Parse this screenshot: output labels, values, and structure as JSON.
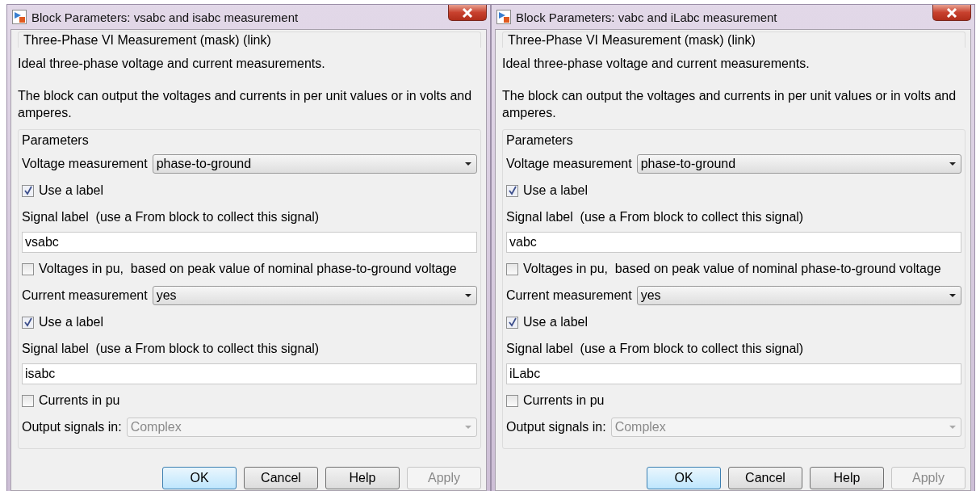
{
  "dialogs": [
    {
      "title": "Block Parameters: vsabc and isabc measurement",
      "header": "Three-Phase VI Measurement (mask) (link)",
      "description": [
        "Ideal three-phase voltage and current measurements.",
        "The block can output the voltages and currents in per unit values or in volts and amperes."
      ],
      "group": "Parameters",
      "rows": [
        {
          "kind": "select",
          "label": "Voltage measurement",
          "value": "phase-to-ground",
          "disabled": false
        },
        {
          "kind": "checkbox",
          "label": "Use a label",
          "checked": true
        },
        {
          "kind": "text",
          "label": "Signal label  (use a From block to collect this signal)"
        },
        {
          "kind": "field",
          "value": "vsabc"
        },
        {
          "kind": "checkbox",
          "label": "Voltages in pu,  based on peak value of nominal phase-to-ground voltage",
          "checked": false
        },
        {
          "kind": "select",
          "label": "Current measurement",
          "value": "yes",
          "disabled": false
        },
        {
          "kind": "checkbox",
          "label": "Use a label",
          "checked": true
        },
        {
          "kind": "text",
          "label": "Signal label  (use a From block to collect this signal)"
        },
        {
          "kind": "field",
          "value": "isabc"
        },
        {
          "kind": "checkbox",
          "label": "Currents in pu",
          "checked": false
        },
        {
          "kind": "select",
          "label": "Output signals in:",
          "value": "Complex",
          "disabled": true
        }
      ],
      "buttons": [
        {
          "label": "OK",
          "selected": true,
          "disabled": false
        },
        {
          "label": "Cancel",
          "selected": false,
          "disabled": false
        },
        {
          "label": "Help",
          "selected": false,
          "disabled": false
        },
        {
          "label": "Apply",
          "selected": false,
          "disabled": true
        }
      ]
    },
    {
      "title": "Block Parameters: vabc and iLabc measurement",
      "header": "Three-Phase VI Measurement (mask) (link)",
      "description": [
        "Ideal three-phase voltage and current measurements.",
        "The block can output the voltages and currents in per unit values or in volts and amperes."
      ],
      "group": "Parameters",
      "rows": [
        {
          "kind": "select",
          "label": "Voltage measurement",
          "value": "phase-to-ground",
          "disabled": false
        },
        {
          "kind": "checkbox",
          "label": "Use a label",
          "checked": true
        },
        {
          "kind": "text",
          "label": "Signal label  (use a From block to collect this signal)"
        },
        {
          "kind": "field",
          "value": "vabc"
        },
        {
          "kind": "checkbox",
          "label": "Voltages in pu,  based on peak value of nominal phase-to-ground voltage",
          "checked": false
        },
        {
          "kind": "select",
          "label": "Current measurement",
          "value": "yes",
          "disabled": false
        },
        {
          "kind": "checkbox",
          "label": "Use a label",
          "checked": true
        },
        {
          "kind": "text",
          "label": "Signal label  (use a From block to collect this signal)"
        },
        {
          "kind": "field",
          "value": "iLabc"
        },
        {
          "kind": "checkbox",
          "label": "Currents in pu",
          "checked": false
        },
        {
          "kind": "select",
          "label": "Output signals in:",
          "value": "Complex",
          "disabled": true
        }
      ],
      "buttons": [
        {
          "label": "OK",
          "selected": true,
          "disabled": false
        },
        {
          "label": "Cancel",
          "selected": false,
          "disabled": false
        },
        {
          "label": "Help",
          "selected": false,
          "disabled": false
        },
        {
          "label": "Apply",
          "selected": false,
          "disabled": true
        }
      ]
    }
  ]
}
